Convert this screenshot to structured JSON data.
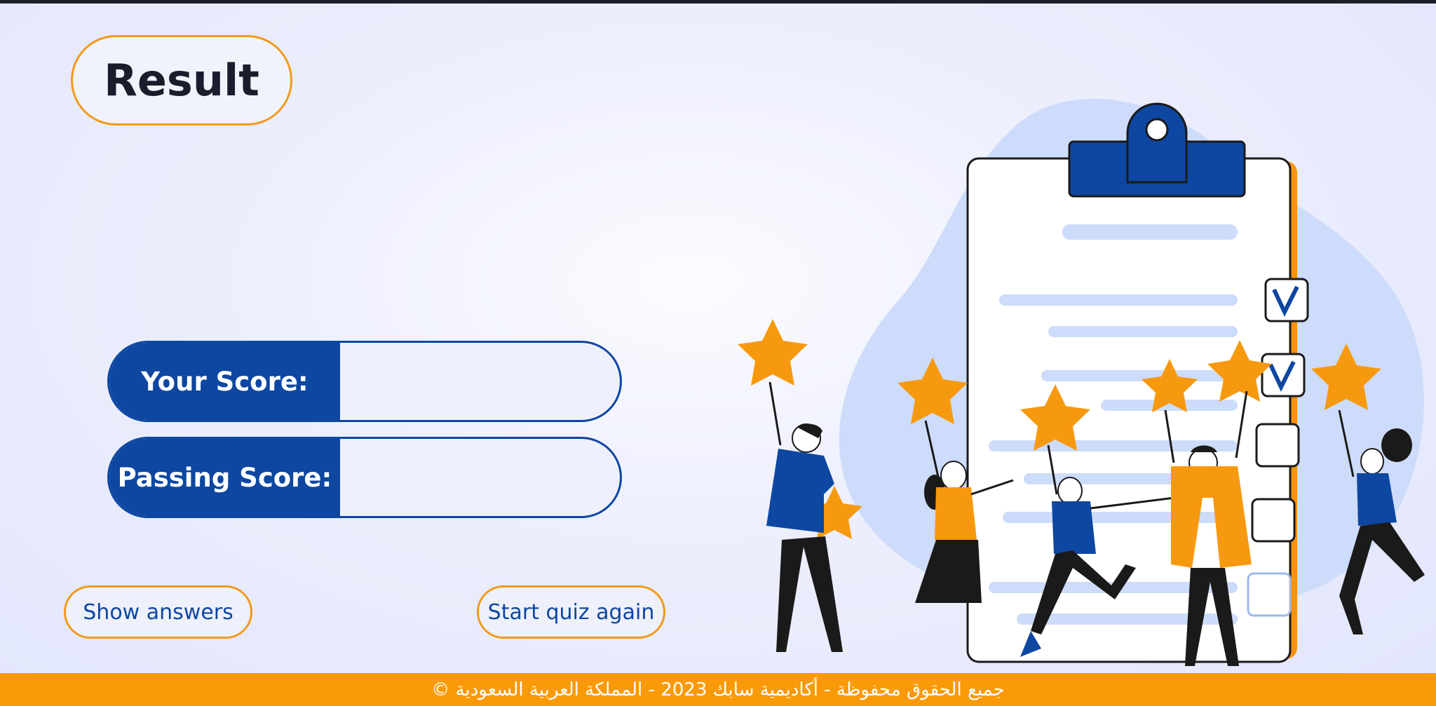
{
  "header": {
    "title": "Result"
  },
  "scores": {
    "your_score_label": "Your Score:",
    "your_score_value": "",
    "passing_score_label": "Passing Score:",
    "passing_score_value": ""
  },
  "actions": {
    "show_answers_label": "Show answers",
    "start_again_label": "Start quiz again"
  },
  "footer": {
    "copyright": "جميع الحقوق محفوظة - أكاديمية سابك 2023 - المملكة العربية السعودية ©"
  },
  "colors": {
    "primary_blue": "#0d47a1",
    "accent_orange": "#f29a1d",
    "footer_orange": "#fa9a08"
  },
  "illustration": {
    "icon": "celebrating-people-with-stars-and-checklist"
  }
}
